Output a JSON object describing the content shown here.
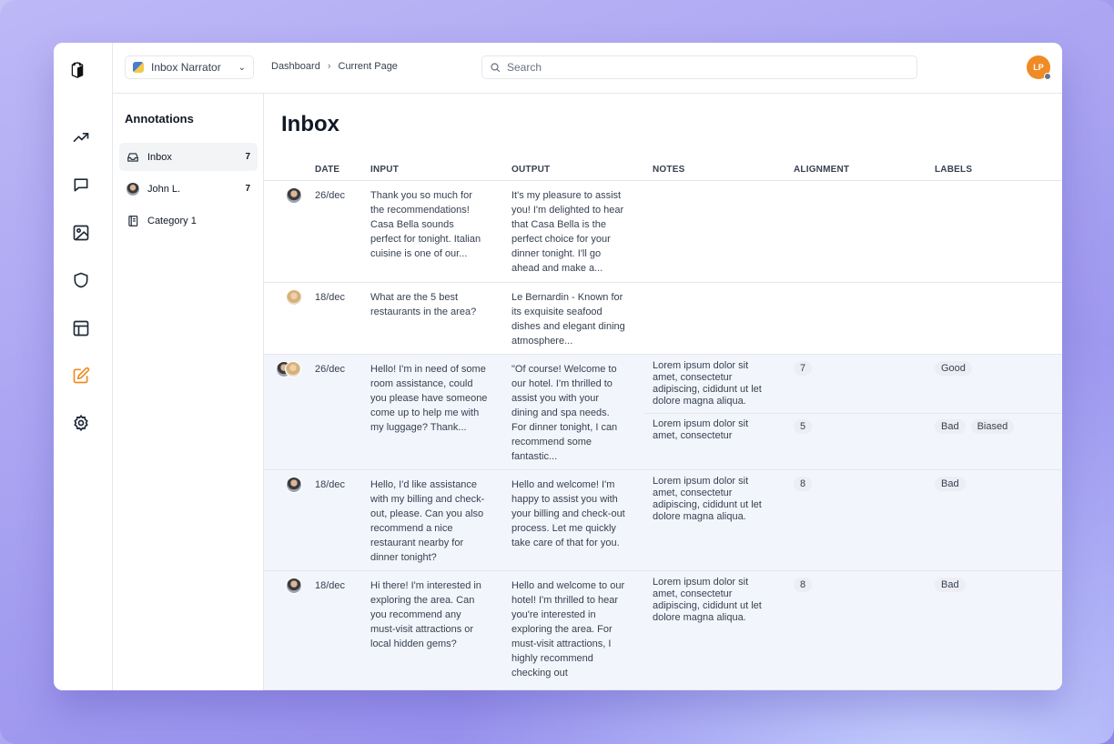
{
  "project": {
    "name": "Inbox Narrator"
  },
  "breadcrumb": [
    "Dashboard",
    "Current Page"
  ],
  "search": {
    "placeholder": "Search"
  },
  "user": {
    "initials": "LP"
  },
  "sidebar": {
    "heading": "Annotations",
    "items": [
      {
        "label": "Inbox",
        "count": "7",
        "icon": "inbox-icon"
      },
      {
        "label": "John L.",
        "count": "7",
        "icon": "avatar"
      },
      {
        "label": "Category 1",
        "count": "",
        "icon": "notebook-icon"
      }
    ]
  },
  "nav_icons": [
    "trending-icon",
    "chat-icon",
    "image-icon",
    "shield-icon",
    "layout-icon",
    "edit-icon",
    "gear-icon"
  ],
  "colors": {
    "accent": "#f08a24",
    "row_highlight": "#f3f5fc",
    "pill": "#eceef3"
  },
  "page": {
    "title": "Inbox"
  },
  "table": {
    "columns": [
      "DATE",
      "INPUT",
      "OUTPUT",
      "NOTES",
      "ALIGNMENT",
      "LABELS"
    ],
    "rows": [
      {
        "date": "26/dec",
        "avatars": [
          "m"
        ],
        "input": [
          "Thank you so much for",
          "the recommendations!",
          "Casa Bella sounds",
          "perfect for tonight. Italian",
          "cuisine is one of our..."
        ],
        "output": [
          "It's my pleasure to assist",
          "you! I'm delighted to hear",
          "that Casa Bella is the",
          "perfect choice for your",
          "dinner tonight. I'll go",
          "ahead and make a..."
        ],
        "annotations": []
      },
      {
        "date": "18/dec",
        "avatars": [
          "f"
        ],
        "input": [
          "What are the 5 best",
          "restaurants in the area?"
        ],
        "output": [
          "Le Bernardin - Known for",
          "its exquisite seafood",
          "dishes and elegant dining",
          "atmosphere..."
        ],
        "annotations": []
      },
      {
        "date": "26/dec",
        "avatars": [
          "m",
          "f"
        ],
        "input": [
          "Hello! I'm in need of some",
          "room assistance, could",
          "you please have someone",
          "come up to help me with",
          "my luggage? Thank..."
        ],
        "output": [
          "\"Of course!  Welcome to",
          "our hotel. I'm thrilled to",
          "assist you with your",
          "dining and  spa needs.",
          "For dinner tonight, I can",
          "recommend some",
          "fantastic..."
        ],
        "annotations": [
          {
            "notes": [
              "Lorem ipsum dolor sit",
              "amet, consectetur",
              "adipiscing, cididunt ut let",
              "dolore magna aliqua."
            ],
            "alignment": "7",
            "labels": [
              "Good"
            ]
          },
          {
            "notes": [
              "Lorem ipsum dolor sit",
              "amet, consectetur"
            ],
            "alignment": "5",
            "labels": [
              "Bad",
              "Biased"
            ]
          }
        ]
      },
      {
        "date": "18/dec",
        "avatars": [
          "m"
        ],
        "input": [
          "Hello, I'd like assistance",
          "with my billing and check-",
          "out, please. Can you also",
          "recommend a nice",
          "restaurant nearby for",
          "dinner tonight?"
        ],
        "output": [
          "Hello and welcome! I'm",
          "happy to assist you with",
          "your billing and check-out",
          "process. Let me quickly",
          "take care of that for you."
        ],
        "annotations": [
          {
            "notes": [
              "Lorem ipsum dolor sit",
              "amet, consectetur",
              "adipiscing, cididunt ut let",
              "dolore magna aliqua."
            ],
            "alignment": "8",
            "labels": [
              "Bad"
            ]
          }
        ]
      },
      {
        "date": "18/dec",
        "avatars": [
          "m"
        ],
        "input": [
          "Hi there! I'm interested in",
          "exploring the area. Can",
          "you recommend any",
          "must-visit attractions or",
          "local hidden gems?"
        ],
        "output": [
          "Hello and welcome to our",
          "hotel! I'm thrilled to hear",
          "you're interested in",
          "exploring the area. For",
          "must-visit attractions, I",
          "highly recommend",
          "checking out"
        ],
        "annotations": [
          {
            "notes": [
              "Lorem ipsum dolor sit",
              "amet, consectetur",
              "adipiscing, cididunt ut let",
              "dolore magna aliqua."
            ],
            "alignment": "8",
            "labels": [
              "Bad"
            ]
          }
        ]
      }
    ]
  }
}
